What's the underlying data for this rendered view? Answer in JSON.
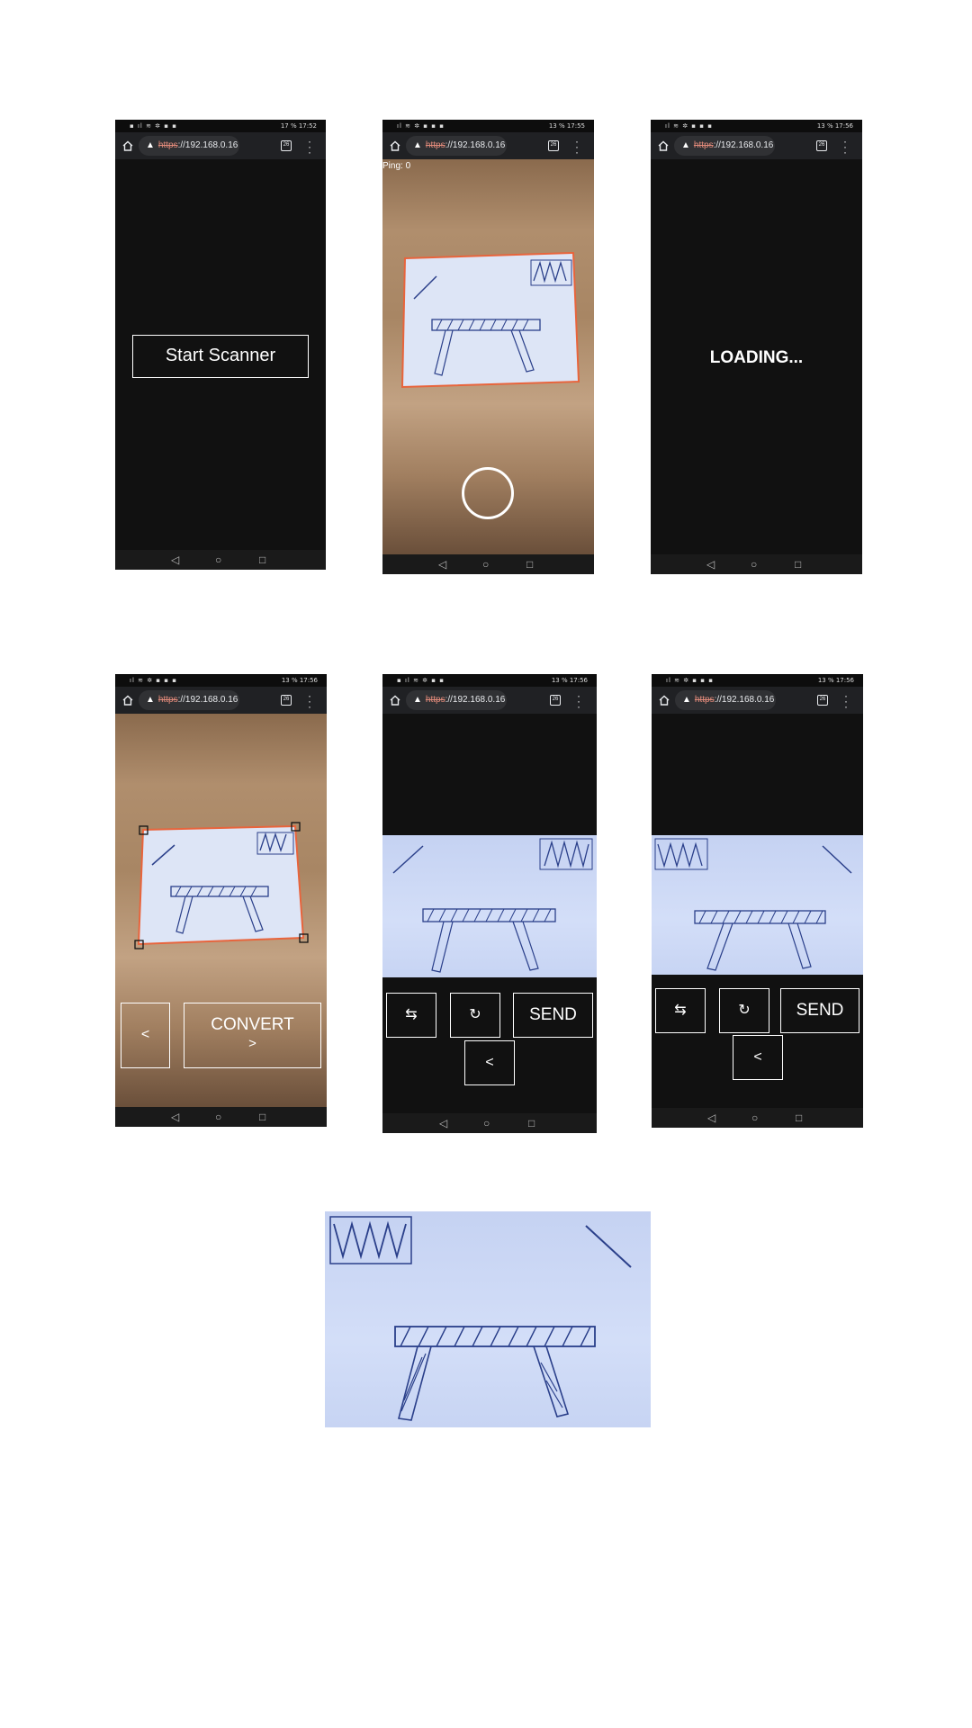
{
  "browser": {
    "url_scheme": "https",
    "url_rest": "://192.168.0.16",
    "tab_count": "26"
  },
  "screens": {
    "start": {
      "status_right": "17 % 17:52",
      "start_button_label": "Start Scanner"
    },
    "camera": {
      "status_right": "13 % 17:55",
      "ping_label": "Ping: 0"
    },
    "loading": {
      "status_right": "13 % 17:56",
      "loading_label": "LOADING..."
    },
    "crop": {
      "status_right": "13 % 17:56",
      "back_label": "<",
      "convert_label": "CONVERT",
      "convert_arrow": ">"
    },
    "result1": {
      "status_right": "13 % 17:56",
      "swap_label": "⇆",
      "rotate_label": "↻",
      "send_label": "SEND",
      "back_label": "<"
    },
    "result2": {
      "status_right": "13 % 17:56",
      "swap_label": "⇆",
      "rotate_label": "↻",
      "send_label": "SEND",
      "back_label": "<"
    }
  },
  "navbar": {
    "back_glyph": "◁",
    "home_glyph": "○",
    "recents_glyph": "□"
  },
  "colors": {
    "crop_border": "#e8643c",
    "phone_bg": "#111111",
    "chrome_bar": "#202124"
  }
}
